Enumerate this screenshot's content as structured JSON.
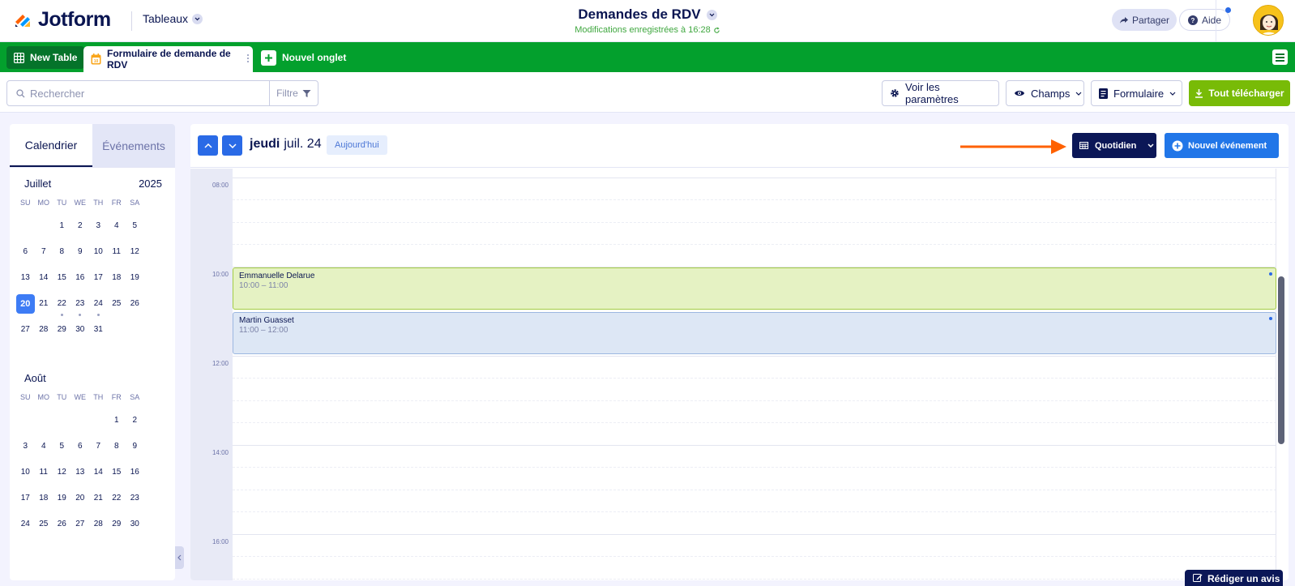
{
  "app": {
    "logo_text": "Jotform",
    "tables_menu": "Tableaux",
    "title": "Demandes de RDV",
    "save_status": "Modifications enregistrées à 16:28",
    "share_label": "Partager",
    "help_label": "Aide"
  },
  "tabs": {
    "new_table": "New Table",
    "active": "Formulaire de demande de RDV",
    "add": "Nouvel onglet"
  },
  "toolbar": {
    "search_placeholder": "Rechercher",
    "filter_label": "Filtre",
    "settings_label": "Voir les paramètres",
    "fields_label": "Champs",
    "form_label": "Formulaire",
    "download_label": "Tout télécharger"
  },
  "sidebar": {
    "tab_calendar": "Calendrier",
    "tab_events": "Événements",
    "days_of_week": [
      "SU",
      "MO",
      "TU",
      "WE",
      "TH",
      "FR",
      "SA"
    ],
    "months": [
      {
        "name": "Juillet",
        "year": "2025",
        "weeks": [
          [
            "",
            "",
            "1",
            "2",
            "3",
            "4",
            "5"
          ],
          [
            "6",
            "7",
            "8",
            "9",
            "10",
            "11",
            "12"
          ],
          [
            "13",
            "14",
            "15",
            "16",
            "17",
            "18",
            "19"
          ],
          [
            "20",
            "21",
            "22",
            "23",
            "24",
            "25",
            "26"
          ],
          [
            "27",
            "28",
            "29",
            "30",
            "31",
            "",
            ""
          ]
        ],
        "selected": "20",
        "event_days": [
          "22",
          "23",
          "24"
        ]
      },
      {
        "name": "Août",
        "year": "",
        "weeks": [
          [
            "",
            "",
            "",
            "",
            "",
            "1",
            "2"
          ],
          [
            "3",
            "4",
            "5",
            "6",
            "7",
            "8",
            "9"
          ],
          [
            "10",
            "11",
            "12",
            "13",
            "14",
            "15",
            "16"
          ],
          [
            "17",
            "18",
            "19",
            "20",
            "21",
            "22",
            "23"
          ],
          [
            "24",
            "25",
            "26",
            "27",
            "28",
            "29",
            "30"
          ]
        ],
        "selected": "",
        "event_days": []
      }
    ]
  },
  "calendar": {
    "day_of_week": "jeudi",
    "date": "juil. 24",
    "today_label": "Aujourd'hui",
    "view_label": "Quotidien",
    "new_event_label": "Nouvel événement",
    "time_labels": [
      "08:00",
      "10:00",
      "12:00",
      "14:00",
      "16:00"
    ],
    "events": [
      {
        "name": "Emmanuelle Delarue",
        "time": "10:00 – 11:00",
        "color": "#e5f2c3",
        "border": "#a4cc44"
      },
      {
        "name": "Martin Guasset",
        "time": "11:00 – 12:00",
        "color": "#dde7f5",
        "border": "#9cb7e0"
      }
    ]
  },
  "feedback_label": "Rédiger un avis",
  "colors": {
    "brand_green": "#03a02d",
    "navy": "#0a1551",
    "accent_blue": "#2176e8",
    "download_green": "#78bb07",
    "arrow_orange": "#ff6100"
  }
}
